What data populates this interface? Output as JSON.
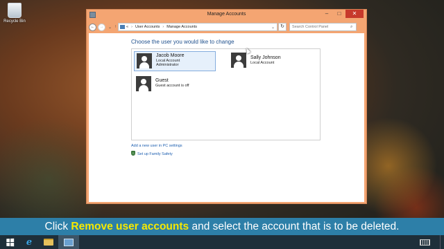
{
  "desktop": {
    "recycle_bin_label": "Recycle Bin"
  },
  "window": {
    "title": "Manage Accounts",
    "controls": {
      "minimize": "–",
      "maximize": "□",
      "close": "✕"
    }
  },
  "addressbar": {
    "back": "←",
    "forward": "→",
    "recent": "⌄",
    "up": "↑",
    "chevron": "«",
    "breadcrumb": [
      "User Accounts",
      "Manage Accounts"
    ],
    "separator": "›",
    "dropdown": "⌄",
    "refresh": "↻",
    "search_placeholder": "Search Control Panel",
    "search_icon": "⌕"
  },
  "main": {
    "heading": "Choose the user you would like to change",
    "accounts": [
      {
        "name": "Jacob Moore",
        "lines": [
          "Local Account",
          "Administrator"
        ],
        "selected": true
      },
      {
        "name": "Sally Johnson",
        "lines": [
          "Local Account"
        ],
        "selected": false
      },
      {
        "name": "Guest",
        "lines": [
          "Guest account is off"
        ],
        "selected": false
      }
    ],
    "links": {
      "add_user": "Add a new user in PC settings",
      "family_safety": "Set up Family Safety"
    }
  },
  "caption": {
    "before": "Click ",
    "highlight": "Remove user accounts",
    "after": " and select the account that is to be deleted."
  },
  "taskbar": {
    "items": [
      "start",
      "internet-explorer",
      "file-explorer",
      "control-panel"
    ]
  },
  "colors": {
    "window_frame": "#f4a572",
    "close_button": "#c7392c",
    "caption_bar": "#2d7fa8",
    "caption_highlight": "#f6e900",
    "link": "#1d5fb0",
    "heading": "#1e4f8c"
  }
}
